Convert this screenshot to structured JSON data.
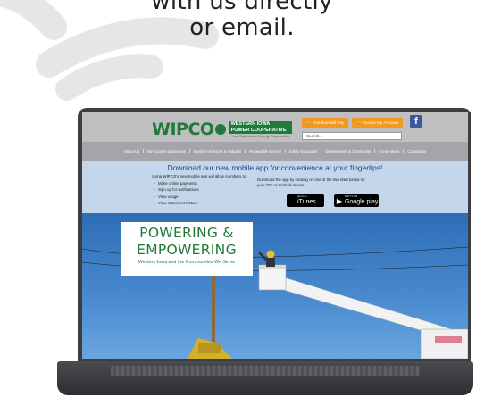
{
  "page": {
    "headline_line1": "with us directly",
    "headline_line2": "or email."
  },
  "site": {
    "logo": {
      "name": "WIPCO",
      "line1": "WESTERN IOWA",
      "line2": "POWER COOPERATIVE",
      "tagline": "Your Touchstone Energy Cooperative"
    },
    "header_buttons": {
      "bill_pay": "One-time Bill Pay",
      "account": "Access My Account"
    },
    "search_placeholder": "Search...",
    "social_icon": "facebook-icon",
    "nav": [
      "About Us",
      "My Account & Services",
      "Member Services & Rebates",
      "Renewable Energy",
      "Safety Education",
      "Development & Community",
      "Co-op News",
      "Contact Us"
    ],
    "promo": {
      "title": "Download our new mobile app for convenience at your fingertips!",
      "intro": "Using WIPCO's new mobile app will allow members to:",
      "bullets": [
        "Make online payments",
        "Sign up for notifications",
        "View usage",
        "View statement history"
      ],
      "right_text": "Download the app by clicking on one of the two links below for your iOS or Android device:",
      "apple_small": "Get it on",
      "apple_big": "iTunes",
      "google_small": "GET IT ON",
      "google_big": "Google play"
    },
    "hero": {
      "line1": "POWERING &",
      "line2": "EMPOWERING",
      "line3": "Western Iowa and the Communities We Serve"
    }
  },
  "colors": {
    "brand_green": "#1f7a3b",
    "orange": "#f39a1e",
    "promo_blue": "#2a3a8c",
    "facebook": "#3b5998"
  }
}
